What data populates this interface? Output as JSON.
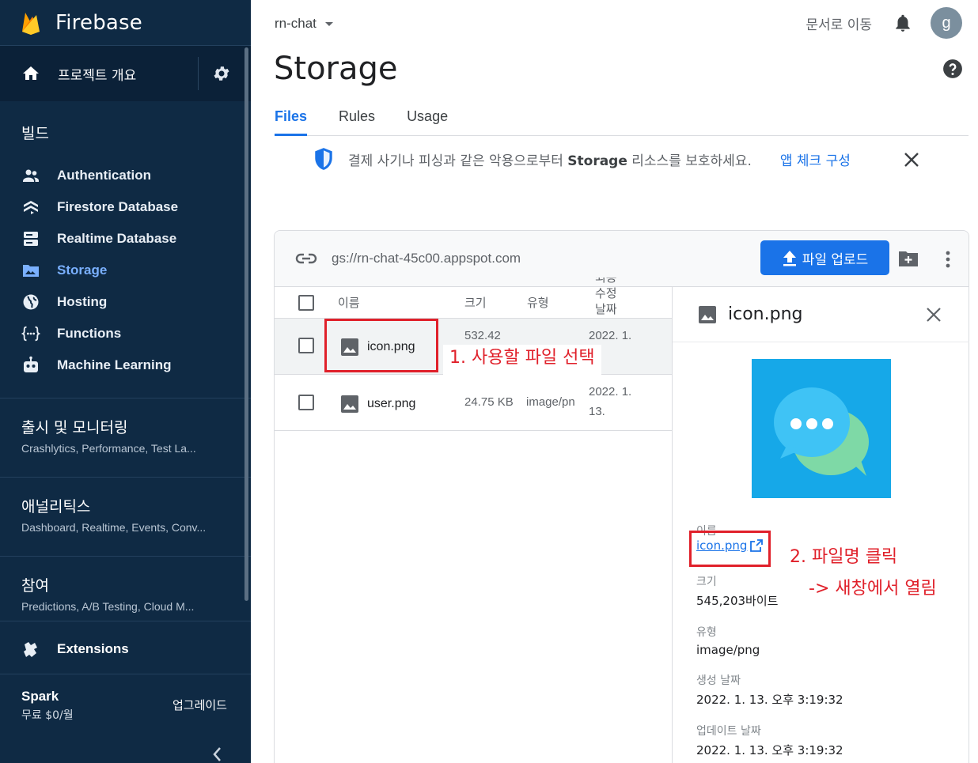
{
  "brand": {
    "name": "Firebase"
  },
  "sidebar": {
    "project_overview": "프로젝트 개요",
    "build_title": "빌드",
    "items": [
      {
        "label": "Authentication",
        "icon": "people-icon"
      },
      {
        "label": "Firestore Database",
        "icon": "firestore-icon"
      },
      {
        "label": "Realtime Database",
        "icon": "database-icon"
      },
      {
        "label": "Storage",
        "icon": "folder-icon",
        "active": true
      },
      {
        "label": "Hosting",
        "icon": "globe-icon"
      },
      {
        "label": "Functions",
        "icon": "functions-icon"
      },
      {
        "label": "Machine Learning",
        "icon": "robot-icon"
      }
    ],
    "groups": [
      {
        "title": "출시 및 모니터링",
        "sub": "Crashlytics, Performance, Test La..."
      },
      {
        "title": "애널리틱스",
        "sub": "Dashboard, Realtime, Events, Conv..."
      },
      {
        "title": "참여",
        "sub": "Predictions, A/B Testing, Cloud M..."
      }
    ],
    "extensions": "Extensions",
    "plan": {
      "name": "Spark",
      "price": "무료 $0/월",
      "upgrade": "업그레이드"
    }
  },
  "header": {
    "project": "rn-chat",
    "docs": "문서로 이동",
    "avatar_letter": "g",
    "title": "Storage"
  },
  "tabs": [
    {
      "label": "Files",
      "active": true
    },
    {
      "label": "Rules"
    },
    {
      "label": "Usage"
    }
  ],
  "banner": {
    "text_before": "결제 사기나 피싱과 같은 악용으로부터 ",
    "text_bold": "Storage",
    "text_after": " 리소스를 보호하세요.",
    "link": "앱 체크 구성"
  },
  "storage": {
    "bucket": "gs://rn-chat-45c00.appspot.com",
    "upload_label": "파일 업로드",
    "columns": {
      "name": "이름",
      "size": "크기",
      "type": "유형",
      "modified_l1": "최종",
      "modified_l2": "수정",
      "modified_l3": "날짜"
    },
    "files": [
      {
        "name": "icon.png",
        "size": "532.42",
        "type": "",
        "modified_l1": "2022. 1.",
        "modified_l2": ""
      },
      {
        "name": "user.png",
        "size": "24.75 KB",
        "type": "image/pn",
        "modified_l1": "2022. 1.",
        "modified_l2": "13."
      }
    ]
  },
  "detail": {
    "title": "icon.png",
    "name_label": "이름",
    "name_value": "icon.png",
    "size_label": "크기",
    "size_value": "545,203바이트",
    "type_label": "유형",
    "type_value": "image/png",
    "created_label": "생성 날짜",
    "created_value": "2022. 1. 13. 오후 3:19:32",
    "updated_label": "업데이트 날짜",
    "updated_value": "2022. 1. 13. 오후 3:19:32"
  },
  "annotations": {
    "step1": "1. 사용할 파일 선택",
    "step2": "2. 파일명 클릭",
    "step2b": "-> 새창에서 열림",
    "color": "#e0202a"
  },
  "colors": {
    "sidebar": "#0f2a44",
    "accent": "#1a73e8",
    "active_nav": "#7ab0ff"
  }
}
